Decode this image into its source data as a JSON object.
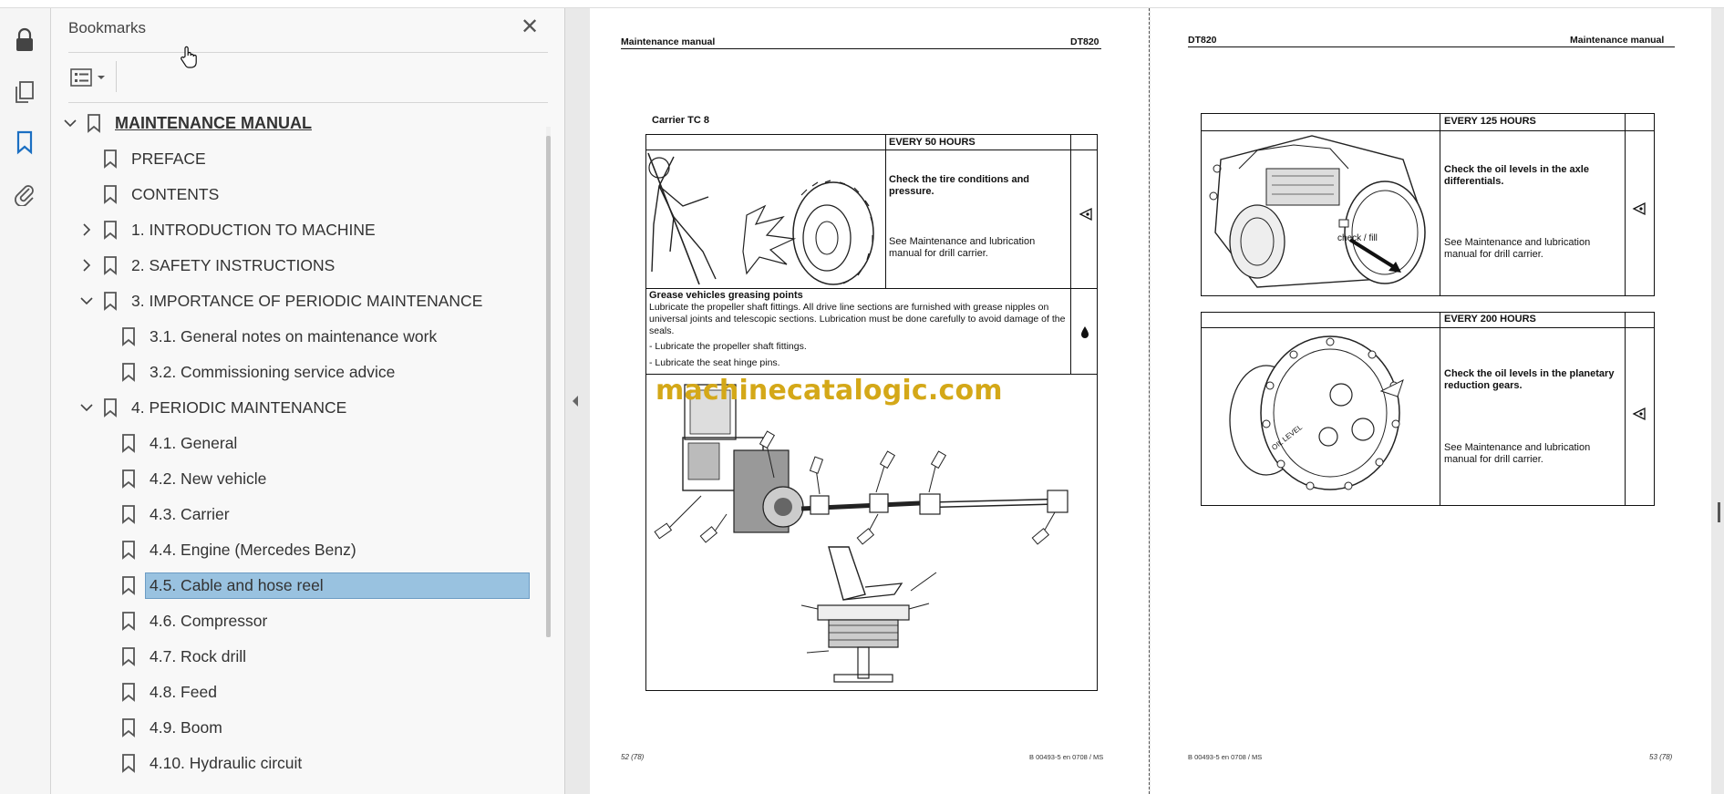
{
  "rail": {
    "items": [
      "lock-icon",
      "pages-icon",
      "bookmark-icon",
      "attachment-icon"
    ]
  },
  "panel": {
    "title": "Bookmarks",
    "close_label": "✕"
  },
  "bookmarks": [
    {
      "label": "MAINTENANCE MANUAL",
      "level": 0,
      "chevron": "down"
    },
    {
      "label": "PREFACE",
      "level": 1,
      "chevron": ""
    },
    {
      "label": "CONTENTS",
      "level": 1,
      "chevron": ""
    },
    {
      "label": "1. INTRODUCTION TO MACHINE",
      "level": 1,
      "chevron": "right"
    },
    {
      "label": "2. SAFETY INSTRUCTIONS",
      "level": 1,
      "chevron": "right"
    },
    {
      "label": "3. IMPORTANCE OF PERIODIC MAINTENANCE",
      "level": 1,
      "chevron": "down"
    },
    {
      "label": "3.1. General notes on maintenance work",
      "level": 2,
      "chevron": ""
    },
    {
      "label": "3.2. Commissioning service advice",
      "level": 2,
      "chevron": ""
    },
    {
      "label": "4. PERIODIC MAINTENANCE",
      "level": 1,
      "chevron": "down"
    },
    {
      "label": "4.1. General",
      "level": 2,
      "chevron": ""
    },
    {
      "label": "4.2. New vehicle",
      "level": 2,
      "chevron": ""
    },
    {
      "label": "4.3. Carrier",
      "level": 2,
      "chevron": ""
    },
    {
      "label": "4.4. Engine (Mercedes Benz)",
      "level": 2,
      "chevron": ""
    },
    {
      "label": "4.5. Cable and hose reel",
      "level": 2,
      "chevron": "",
      "selected": true
    },
    {
      "label": "4.6. Compressor",
      "level": 2,
      "chevron": ""
    },
    {
      "label": "4.7. Rock drill",
      "level": 2,
      "chevron": ""
    },
    {
      "label": "4.8. Feed",
      "level": 2,
      "chevron": ""
    },
    {
      "label": "4.9. Boom",
      "level": 2,
      "chevron": ""
    },
    {
      "label": "4.10. Hydraulic circuit",
      "level": 2,
      "chevron": ""
    }
  ],
  "page_left": {
    "header_left": "Maintenance manual",
    "header_right": "DT820",
    "section_title": "Carrier TC 8",
    "interval1": "EVERY 50 HOURS",
    "check1": "Check the tire conditions and pressure.",
    "see1": "See Maintenance and lubrication manual for drill carrier.",
    "grease_title": "Grease vehicles greasing points",
    "grease_text": "Lubricate the propeller shaft fittings. All drive line sections are furnished with grease nipples on universal joints and telescopic sections. Lubrication must be done carefully to avoid damage of the seals.",
    "bullet1": "- Lubricate the propeller shaft fittings.",
    "bullet2": "- Lubricate the seat hinge pins.",
    "watermark": "machinecatalogic.com",
    "footer_left": "52 (78)",
    "footer_right": "B 00493-5 en 0708 / MS"
  },
  "page_right": {
    "header_left": "DT820",
    "header_right": "Maintenance manual",
    "interval1": "EVERY 125 HOURS",
    "check1": "Check the oil levels in the axle differentials.",
    "see1": "See Maintenance and lubrication manual for drill carrier.",
    "callout": "check / fill",
    "interval2": "EVERY 200 HOURS",
    "check2": "Check the oil levels in the planetary reduction gears.",
    "see2": "See Maintenance and lubrication manual for drill carrier.",
    "oil_level_label": "OIL LEVEL",
    "footer_left": "B 00493-5 en 0708 / MS",
    "footer_right": "53 (78)"
  }
}
